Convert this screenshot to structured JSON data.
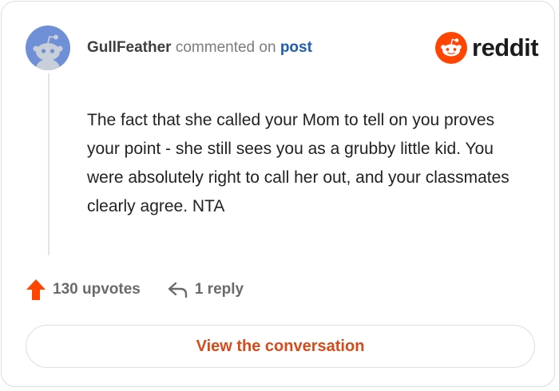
{
  "comment": {
    "username": "GullFeather",
    "action_text": "commented on",
    "post_link": "post",
    "body": "The fact that she called your Mom to tell on you proves your point - she still sees you as a grubby little kid. You were absolutely right to call her out, and your classmates clearly agree. NTA"
  },
  "brand": {
    "name": "reddit",
    "icon": "reddit-snoo-icon",
    "color": "#ff4500"
  },
  "actions": {
    "upvotes_label": "130 upvotes",
    "reply_label": "1 reply"
  },
  "footer": {
    "view_button_label": "View the conversation"
  },
  "colors": {
    "avatar_bg": "#6f8fd6",
    "upvote_arrow": "#ff4500",
    "link": "#1d5db3",
    "cta_text": "#d94a1a"
  }
}
